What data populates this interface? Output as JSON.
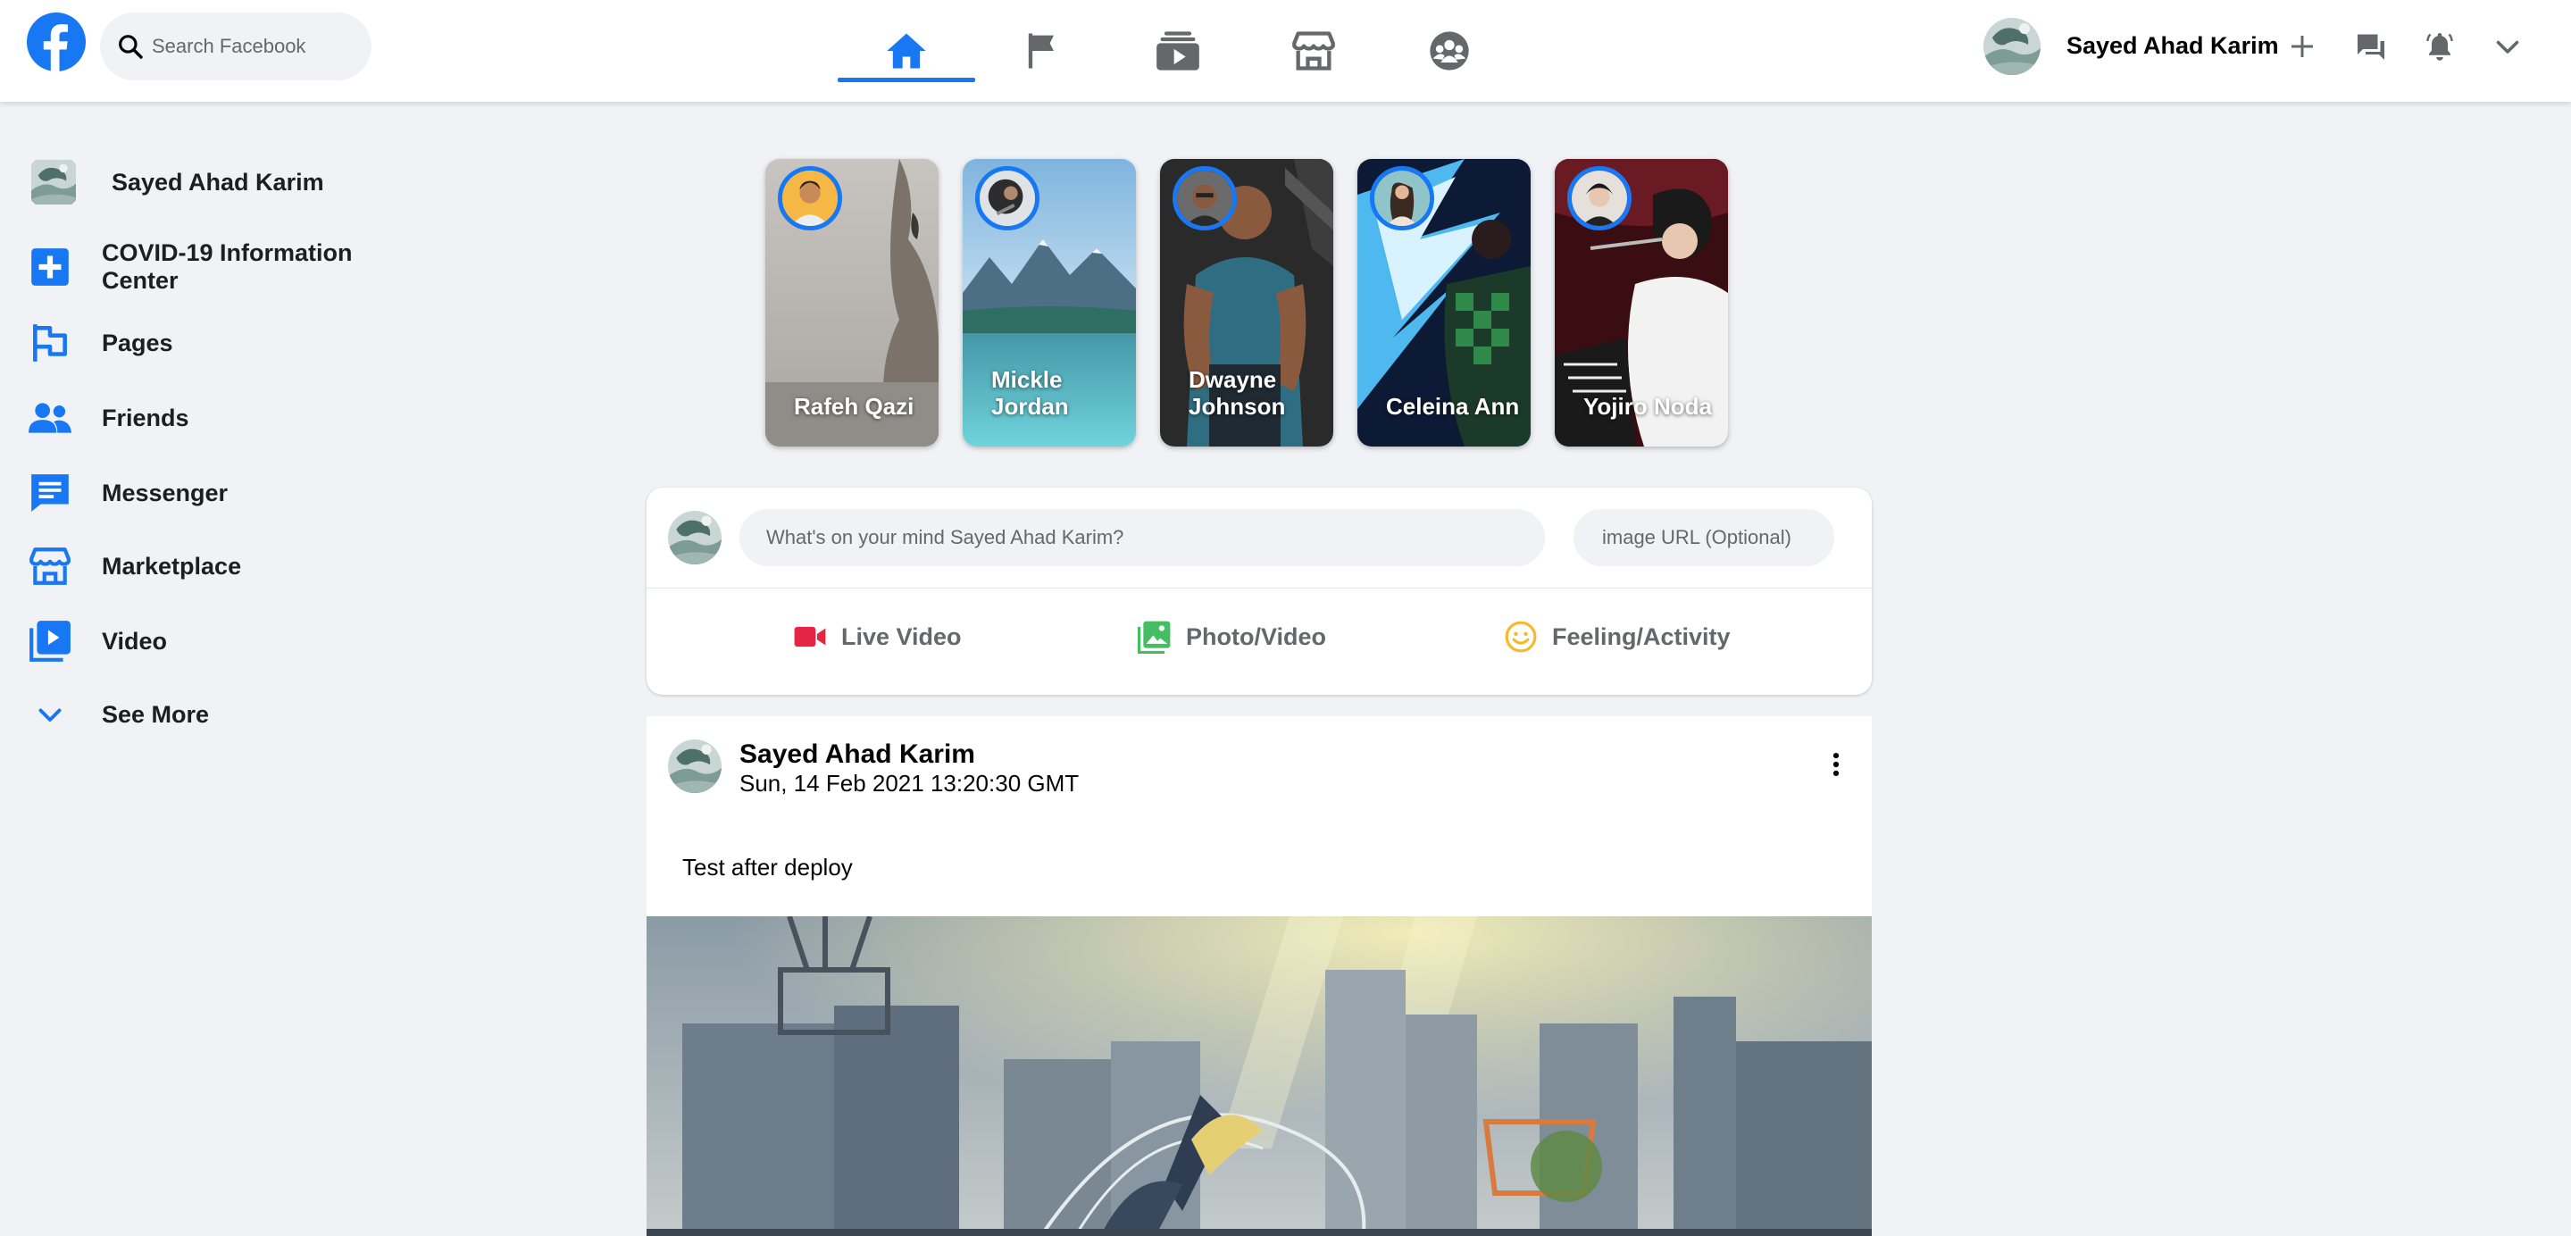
{
  "search": {
    "placeholder": "Search Facebook"
  },
  "header": {
    "nav_icons": [
      "home-icon",
      "pages-flag-icon",
      "watch-icon",
      "marketplace-icon",
      "groups-icon"
    ],
    "active_nav": "home",
    "user_name": "Sayed Ahad Karim",
    "right_icons": [
      "plus-icon",
      "messenger-icon",
      "notifications-icon",
      "chevron-down-icon"
    ]
  },
  "sidebar": {
    "user_name": "Sayed Ahad Karim",
    "items": [
      {
        "label": "COVID-19 Information Center",
        "icon": "covid-info-icon"
      },
      {
        "label": "Pages",
        "icon": "pages-flag-icon"
      },
      {
        "label": "Friends",
        "icon": "friends-icon"
      },
      {
        "label": "Messenger",
        "icon": "messenger-icon"
      },
      {
        "label": "Marketplace",
        "icon": "marketplace-icon"
      },
      {
        "label": "Video",
        "icon": "video-icon"
      },
      {
        "label": "See More",
        "icon": "chevron-down-icon"
      }
    ]
  },
  "stories": [
    {
      "name": "Rafeh Qazi"
    },
    {
      "name": "Mickle Jordan"
    },
    {
      "name": "Dwayne Johnson"
    },
    {
      "name": "Celeina Ann"
    },
    {
      "name": "Yojiro Noda"
    }
  ],
  "composer": {
    "placeholder": "What's on your mind Sayed Ahad Karim?",
    "url_placeholder": "image URL (Optional)",
    "actions": [
      {
        "label": "Live Video",
        "icon": "live-video-icon",
        "color": "#e42645"
      },
      {
        "label": "Photo/Video",
        "icon": "photo-icon",
        "color": "#45bd62"
      },
      {
        "label": "Feeling/Activity",
        "icon": "feeling-icon",
        "color": "#f7b928"
      }
    ]
  },
  "post": {
    "author": "Sayed Ahad Karim",
    "timestamp": "Sun, 14 Feb 2021 13:20:30 GMT",
    "text": "Test after deploy"
  },
  "colors": {
    "brand": "#1877f2",
    "background": "#f0f2f5",
    "card": "#ffffff"
  }
}
